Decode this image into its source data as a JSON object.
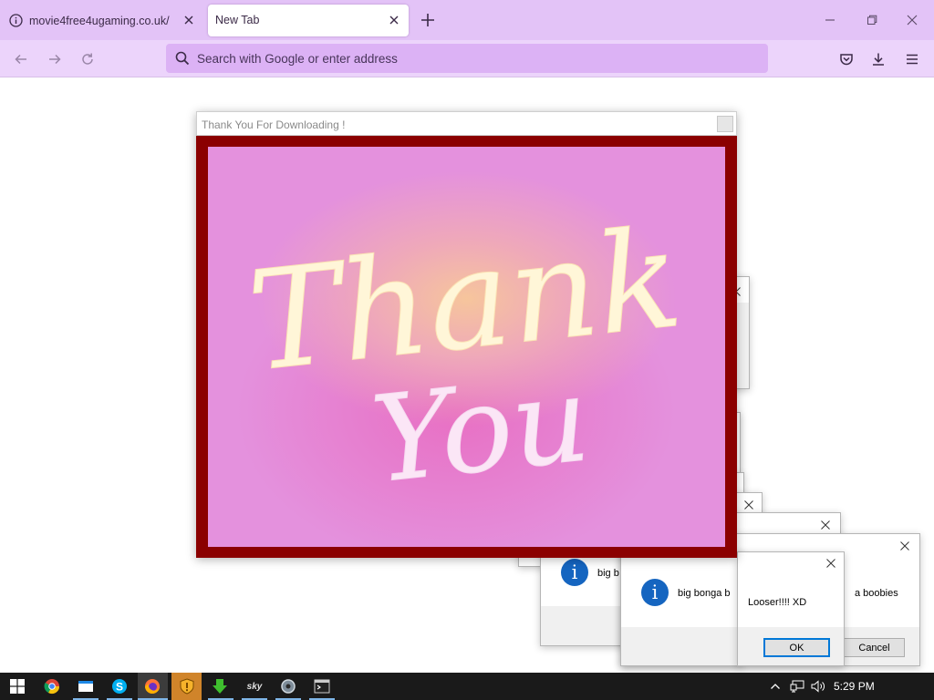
{
  "browser": {
    "tabs": [
      {
        "label": "movie4free4ugaming.co.uk/",
        "active": false
      },
      {
        "label": "New Tab",
        "active": true
      }
    ],
    "new_tab_glyph": "+",
    "address_placeholder": "Search with Google or enter address",
    "icons": [
      "info-icon",
      "close-icon",
      "plus-icon",
      "minimize-icon",
      "restore-icon",
      "back-icon",
      "forward-icon",
      "reload-icon",
      "search-icon",
      "pocket-icon",
      "download-icon",
      "menu-icon"
    ]
  },
  "thank_you_popup": {
    "title": "Thank You For Downloading !",
    "image_text_line1": "Thank",
    "image_text_line2": "You",
    "frame_color": "#8b0000",
    "background_color": "#e491dd"
  },
  "dialogs": {
    "msg_a": "big b",
    "msg_b": "big bonga b",
    "msg_c": "a boobies",
    "looser": "Looser!!!! XD",
    "ok_label": "OK",
    "cancel_label": "Cancel"
  },
  "taskbar": {
    "time": "5:29 PM",
    "apps": [
      "windows-start",
      "chrome",
      "file-explorer",
      "skype",
      "firefox",
      "security-shield",
      "download-manager",
      "sky",
      "settings",
      "terminal"
    ]
  }
}
